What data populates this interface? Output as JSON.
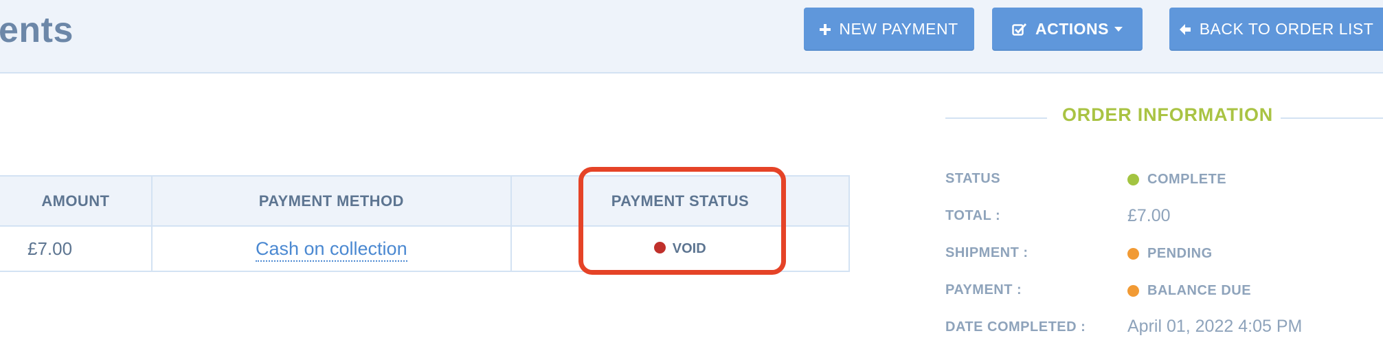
{
  "header": {
    "title": "ents",
    "buttons": {
      "new_payment": "NEW PAYMENT",
      "actions": "ACTIONS",
      "back": "BACK TO ORDER LIST"
    }
  },
  "payments_table": {
    "columns": [
      "AMOUNT",
      "PAYMENT METHOD",
      "PAYMENT STATUS"
    ],
    "rows": [
      {
        "amount": "£7.00",
        "method": "Cash on collection",
        "status": "VOID",
        "status_color": "#c0302b"
      }
    ]
  },
  "order_information": {
    "title": "ORDER INFORMATION",
    "status_label": "STATUS",
    "status_value": "COMPLETE",
    "status_color": "#a3c441",
    "total_label": "TOTAL :",
    "total_value": "£7.00",
    "shipment_label": "SHIPMENT :",
    "shipment_value": "PENDING",
    "shipment_color": "#f19a34",
    "payment_label": "PAYMENT :",
    "payment_value": "BALANCE DUE",
    "payment_color": "#f19a34",
    "date_label": "DATE COMPLETED :",
    "date_value": "April 01, 2022 4:05 PM"
  },
  "colors": {
    "accent": "#5f97db",
    "highlight": "#e54327",
    "header_bg": "#eef3fa"
  }
}
